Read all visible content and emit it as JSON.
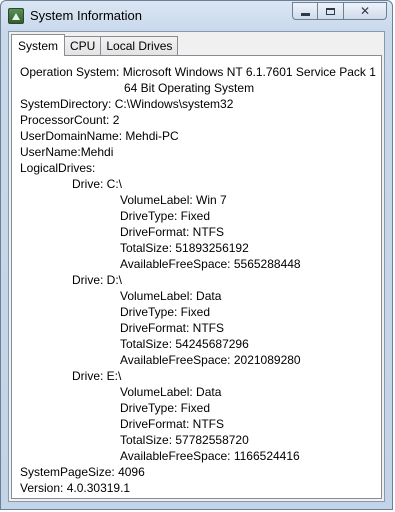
{
  "window": {
    "title": "System Information"
  },
  "tabs": [
    {
      "label": "System"
    },
    {
      "label": "CPU"
    },
    {
      "label": "Local Drives"
    }
  ],
  "system": {
    "os_label": "Operation System:",
    "os_value": "Microsoft Windows NT 6.1.7601 Service Pack 1",
    "os_value_cont": "64 Bit Operating System",
    "sysdir_label": "SystemDirectory:",
    "sysdir_value": "C:\\Windows\\system32",
    "proc_label": "ProcessorCount:",
    "proc_value": "2",
    "domain_label": "UserDomainName:",
    "domain_value": "Mehdi-PC",
    "user_label": "UserName:",
    "user_value": "Mehdi",
    "logical_label": "LogicalDrives:",
    "drives": [
      {
        "drive_label": "Drive: C:\\",
        "volume_label": "VolumeLabel: Win 7",
        "drive_type": "DriveType: Fixed",
        "drive_format": "DriveFormat: NTFS",
        "total_size": "TotalSize: 51893256192",
        "free_space": "AvailableFreeSpace: 5565288448"
      },
      {
        "drive_label": "Drive: D:\\",
        "volume_label": "VolumeLabel: Data",
        "drive_type": "DriveType: Fixed",
        "drive_format": "DriveFormat: NTFS",
        "total_size": "TotalSize: 54245687296",
        "free_space": "AvailableFreeSpace: 2021089280"
      },
      {
        "drive_label": "Drive: E:\\",
        "volume_label": "VolumeLabel: Data",
        "drive_type": "DriveType: Fixed",
        "drive_format": "DriveFormat: NTFS",
        "total_size": "TotalSize: 57782558720",
        "free_space": "AvailableFreeSpace: 1166524416"
      }
    ],
    "pagesize_label": "SystemPageSize:",
    "pagesize_value": "4096",
    "version_label": "Version:",
    "version_value": "4.0.30319.1"
  }
}
